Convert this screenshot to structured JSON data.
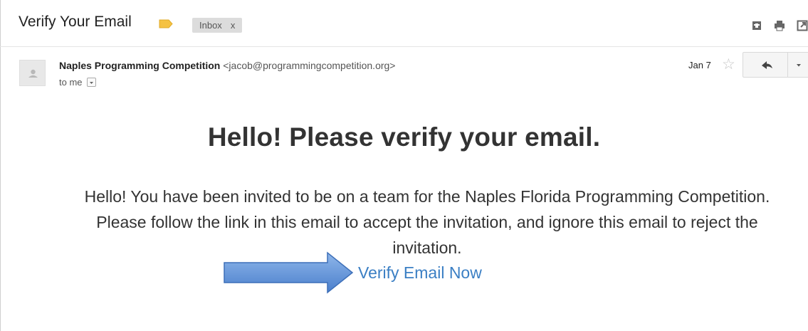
{
  "subject": {
    "title": "Verify Your Email",
    "label_color": "#f5c242",
    "inbox_chip": {
      "label": "Inbox",
      "remove": "x"
    }
  },
  "toolbar_icons": [
    "archive-icon",
    "print-icon",
    "new-window-icon"
  ],
  "message": {
    "sender_name": "Naples Programming Competition",
    "sender_email": "<jacob@programmingcompetition.org>",
    "recipient": "to me",
    "date": "Jan 7"
  },
  "email_body": {
    "headline": "Hello! Please verify your email.",
    "text": "Hello! You have been invited to be on a team for the Naples Florida Programming Competition. Please follow the link in this email to accept the invitation, and ignore this email to reject the invitation.",
    "link_text": "Verify Email Now",
    "link_color": "#3b7fc4"
  },
  "annotation": {
    "arrow_color": "#5b8fd6"
  }
}
